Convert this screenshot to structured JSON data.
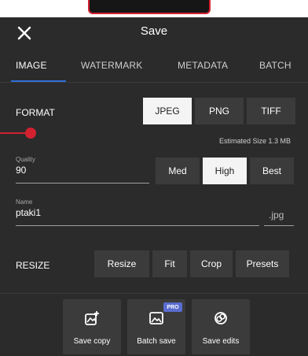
{
  "header": {
    "title": "Save"
  },
  "tabs": [
    {
      "label": "IMAGE",
      "active": true
    },
    {
      "label": "WATERMARK",
      "active": false
    },
    {
      "label": "METADATA",
      "active": false
    },
    {
      "label": "BATCH",
      "active": false
    }
  ],
  "format": {
    "label": "FORMAT",
    "options": [
      "JPEG",
      "PNG",
      "TIFF"
    ],
    "selected": "JPEG",
    "estimated_size": "Estimated Size 1.3 MB"
  },
  "quality": {
    "label": "Quality",
    "value": "90",
    "presets": [
      "Med",
      "High",
      "Best"
    ],
    "selected_preset": "High"
  },
  "name": {
    "label": "Name",
    "value": "ptaki1",
    "extension": ".jpg"
  },
  "resize": {
    "label": "RESIZE",
    "options": [
      "Resize",
      "Fit",
      "Crop",
      "Presets"
    ]
  },
  "actions": [
    {
      "label": "Save copy",
      "icon": "image-add-icon"
    },
    {
      "label": "Batch save",
      "icon": "image-icon",
      "badge": "PRO"
    },
    {
      "label": "Save edits",
      "icon": "shapes-icon"
    }
  ],
  "colors": {
    "background": "#2b2b2b",
    "button": "#3b3b3b",
    "selected": "#f4f4f4",
    "accent_tab": "#2f6fd8",
    "marker_red": "#d3212f",
    "badge": "#5a6ccf"
  }
}
